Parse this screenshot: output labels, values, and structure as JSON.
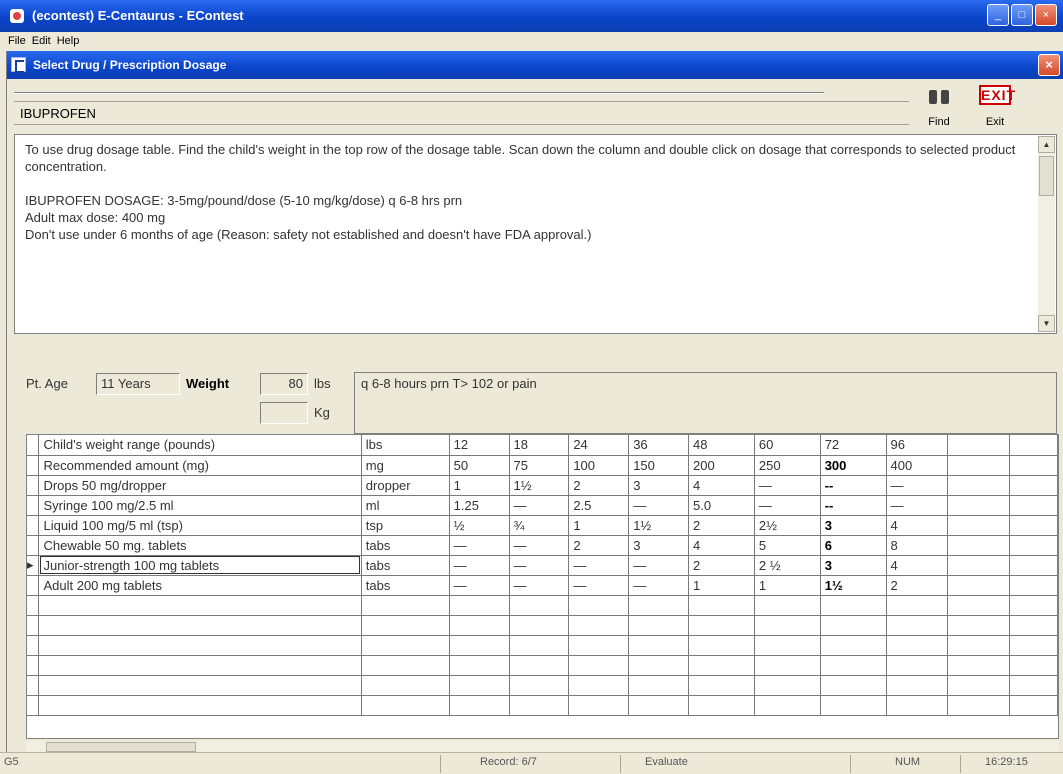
{
  "app": {
    "title": "(econtest) E-Centaurus - EContest"
  },
  "menu": [
    "File",
    "Edit",
    "Help"
  ],
  "dialog": {
    "title": "Select Drug / Prescription Dosage",
    "drug_name": "IBUPROFEN",
    "find_label": "Find",
    "exit_label": "Exit",
    "exit_sign": "EXIT"
  },
  "instructions": {
    "line1": "To use drug dosage table. Find the child's weight in the top row of the dosage table. Scan down the column and double click on dosage that corresponds to selected product concentration.",
    "line2": "IBUPROFEN DOSAGE:  3-5mg/pound/dose (5-10 mg/kg/dose) q 6-8 hrs prn",
    "line3": "Adult max dose: 400 mg",
    "line4": "Don't use under 6 months of age (Reason: safety not established and doesn't have FDA approval.)"
  },
  "patient": {
    "age_label": "Pt. Age",
    "age_value": "11 Years",
    "weight_label": "Weight",
    "weight_lbs": "80",
    "lbs_unit": "lbs",
    "weight_kg": "",
    "kg_unit": "Kg",
    "note": "q 6-8 hours prn T> 102 or pain"
  },
  "grid": {
    "rows": [
      {
        "cells": [
          "Child's weight range (pounds)",
          "lbs",
          "12",
          "18",
          "24",
          "36",
          "48",
          "60",
          "72",
          "96"
        ],
        "bold": []
      },
      {
        "cells": [
          "Recommended amount (mg)",
          "mg",
          "50",
          "75",
          "100",
          "150",
          "200",
          "250",
          "300",
          "400"
        ],
        "bold": [
          8
        ]
      },
      {
        "cells": [
          "Drops 50 mg/dropper",
          "dropper",
          "1",
          "1½",
          "2",
          "3",
          "4",
          "—",
          "--",
          "—"
        ],
        "bold": [
          8
        ]
      },
      {
        "cells": [
          "Syringe  100 mg/2.5 ml",
          "ml",
          "1.25",
          "—",
          "2.5",
          "—",
          "5.0",
          "—",
          "--",
          "—"
        ],
        "bold": [
          8
        ]
      },
      {
        "cells": [
          "Liquid 100 mg/5 ml (tsp)",
          "tsp",
          "½",
          "¾",
          "1",
          "1½",
          "2",
          "2½",
          "3",
          "4"
        ],
        "bold": [
          8
        ]
      },
      {
        "cells": [
          "Chewable 50 mg. tablets",
          "tabs",
          "—",
          "—",
          "2",
          "3",
          "4",
          "5",
          "6",
          "8"
        ],
        "bold": [
          8
        ]
      },
      {
        "cells": [
          "Junior-strength 100 mg tablets",
          "tabs",
          "—",
          "—",
          "—",
          "—",
          "2",
          "2 ½",
          "3",
          "4"
        ],
        "bold": [
          8
        ],
        "current": true
      },
      {
        "cells": [
          "Adult 200 mg  tablets",
          "tabs",
          "—",
          "—",
          "—",
          "—",
          "1",
          "1",
          "1½",
          "2"
        ],
        "bold": [
          8
        ]
      }
    ]
  },
  "status": {
    "left": "G5",
    "record": "Record: 6/7",
    "mode": "Evaluate",
    "num": "NUM",
    "time": "16:29:15"
  }
}
